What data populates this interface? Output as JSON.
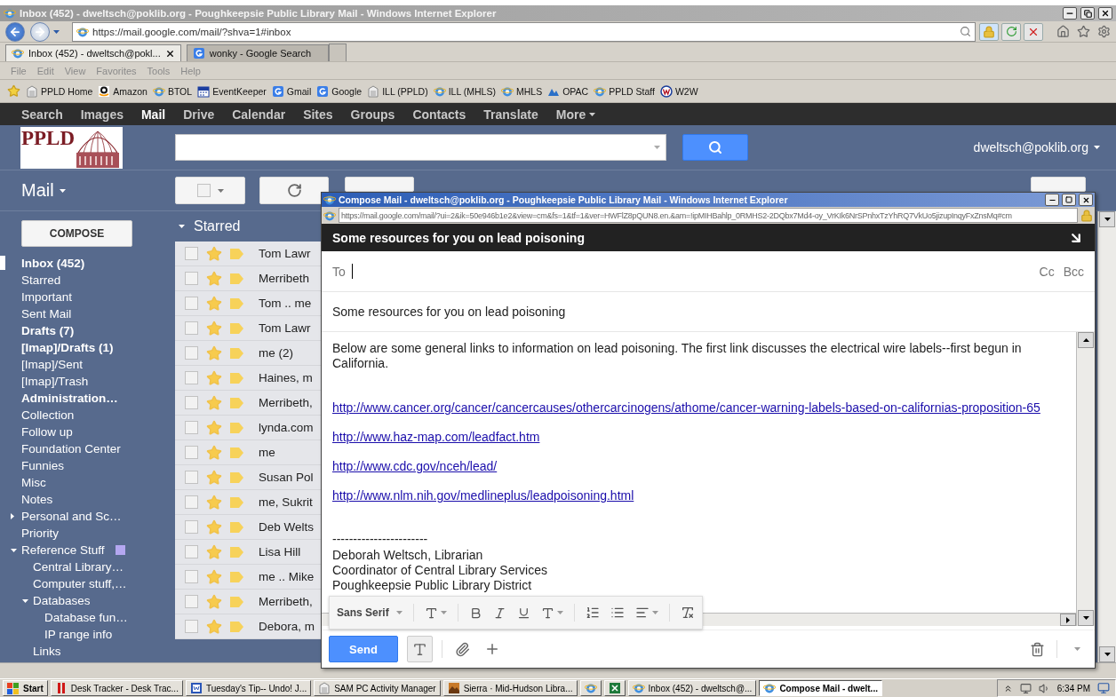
{
  "browser": {
    "title": "Inbox (452) - dweltsch@poklib.org - Poughkeepsie Public Library Mail - Windows Internet Explorer",
    "url": "https://mail.google.com/mail/?shva=1#inbox",
    "tabs": [
      {
        "label": "Inbox (452) - dweltsch@pokl...",
        "kind": "browser",
        "selected": true
      },
      {
        "label": "wonky - Google Search",
        "kind": "google",
        "selected": false
      }
    ],
    "menu": [
      "File",
      "Edit",
      "View",
      "Favorites",
      "Tools",
      "Help"
    ],
    "favorites": [
      {
        "label": "PPLD Home",
        "kind": "page"
      },
      {
        "label": "Amazon",
        "kind": "amazon"
      },
      {
        "label": "BTOL",
        "kind": "browser"
      },
      {
        "label": "EventKeeper",
        "kind": "calendar"
      },
      {
        "label": "Gmail",
        "kind": "google"
      },
      {
        "label": "Google",
        "kind": "google"
      },
      {
        "label": "ILL (PPLD)",
        "kind": "page"
      },
      {
        "label": "ILL (MHLS)",
        "kind": "browser"
      },
      {
        "label": "MHLS",
        "kind": "browser"
      },
      {
        "label": "OPAC",
        "kind": "wave"
      },
      {
        "label": "PPLD Staff",
        "kind": "browser"
      },
      {
        "label": "W2W",
        "kind": "ring"
      }
    ]
  },
  "google_bar": {
    "items": [
      {
        "label": "Search",
        "selected": false
      },
      {
        "label": "Images",
        "selected": false
      },
      {
        "label": "Mail",
        "selected": true
      },
      {
        "label": "Drive",
        "selected": false
      },
      {
        "label": "Calendar",
        "selected": false
      },
      {
        "label": "Sites",
        "selected": false
      },
      {
        "label": "Groups",
        "selected": false
      },
      {
        "label": "Contacts",
        "selected": false
      },
      {
        "label": "Translate",
        "selected": false
      },
      {
        "label": "More",
        "selected": false
      }
    ]
  },
  "gmail": {
    "logo": "PPLD",
    "account": "dweltsch@poklib.org",
    "app_switch": "Mail",
    "compose": "COMPOSE",
    "labels": [
      {
        "label": "Inbox (452)",
        "unread": true,
        "selected": true
      },
      {
        "label": "Starred",
        "unread": false,
        "selected": false
      },
      {
        "label": "Important",
        "unread": false,
        "selected": false
      },
      {
        "label": "Sent Mail",
        "unread": false,
        "selected": false
      },
      {
        "label": "Drafts (7)",
        "unread": true,
        "selected": false
      },
      {
        "label": "[Imap]/Drafts (1)",
        "unread": true,
        "selected": false
      },
      {
        "label": "[Imap]/Sent",
        "unread": false,
        "selected": false
      },
      {
        "label": "[Imap]/Trash",
        "unread": false,
        "selected": false
      },
      {
        "label": "Administration…",
        "unread": true,
        "selected": false
      },
      {
        "label": "Collection",
        "unread": false,
        "selected": false
      },
      {
        "label": "Follow up",
        "unread": false,
        "selected": false
      },
      {
        "label": "Foundation Center",
        "unread": false,
        "selected": false
      },
      {
        "label": "Funnies",
        "unread": false,
        "selected": false
      },
      {
        "label": "Misc",
        "unread": false,
        "selected": false
      },
      {
        "label": "Notes",
        "unread": false,
        "selected": false
      },
      {
        "label": "Personal and Sc…",
        "unread": false,
        "selected": false,
        "expanded": false
      },
      {
        "label": "Priority",
        "unread": false,
        "selected": false
      },
      {
        "label": "Reference Stuff",
        "unread": false,
        "selected": false,
        "expanded": true,
        "color": "#b4a7f0",
        "children": [
          {
            "label": "Central Library…",
            "unread": false,
            "selected": false
          },
          {
            "label": "Computer stuff,…",
            "unread": false,
            "selected": false
          },
          {
            "label": "Databases",
            "unread": false,
            "selected": false,
            "expanded": true,
            "children": [
              {
                "label": "Database fun…",
                "unread": false,
                "selected": false
              },
              {
                "label": "IP range info",
                "unread": false,
                "selected": false
              }
            ]
          },
          {
            "label": "Links",
            "unread": false,
            "selected": false
          }
        ]
      }
    ],
    "section": "Starred",
    "messages": [
      {
        "sender": "Tom Lawr",
        "checked": false,
        "starred": true
      },
      {
        "sender": "Merribeth",
        "checked": false,
        "starred": true
      },
      {
        "sender": "Tom .. me",
        "checked": false,
        "starred": true
      },
      {
        "sender": "Tom Lawr",
        "checked": false,
        "starred": true
      },
      {
        "sender": "me (2)",
        "checked": false,
        "starred": true
      },
      {
        "sender": "Haines, m",
        "checked": false,
        "starred": true
      },
      {
        "sender": "Merribeth,",
        "checked": false,
        "starred": true
      },
      {
        "sender": "lynda.com",
        "checked": false,
        "starred": true
      },
      {
        "sender": "me",
        "checked": false,
        "starred": true
      },
      {
        "sender": "Susan Pol",
        "checked": false,
        "starred": true
      },
      {
        "sender": "me, Sukrit",
        "checked": false,
        "starred": true
      },
      {
        "sender": "Deb Welts",
        "checked": false,
        "starred": true
      },
      {
        "sender": "Lisa Hill",
        "checked": false,
        "starred": true
      },
      {
        "sender": "me .. Mike",
        "checked": false,
        "starred": true
      },
      {
        "sender": "Merribeth,",
        "checked": false,
        "starred": true
      },
      {
        "sender": "Debora, m",
        "checked": false,
        "starred": true
      }
    ]
  },
  "compose_window": {
    "title": "Compose Mail - dweltsch@poklib.org - Poughkeepsie Public Library Mail - Windows Internet Explorer",
    "url": "https://mail.google.com/mail/?ui=2&ik=50e946b1e2&view=cm&fs=1&tf=1&ver=HWFlZ8pQUN8.en.&am=!ipMIHBahlp_0RMHS2-2DQbx7Md4-oy_VrKIk6NrSPnhxTzYhRQ7VkUo5jizupInqyFxZnsMq#cm",
    "heading": "Some resources for you on lead poisoning",
    "to_label": "To",
    "cc": "Cc",
    "bcc": "Bcc",
    "subject": "Some resources for you on lead poisoning",
    "body": [
      {
        "kind": "text",
        "text": "Below are some general links to information on lead poisoning. The first link discusses the electrical wire labels--first begun in California."
      },
      {
        "kind": "link",
        "text": "http://www.cancer.org/cancer/cancercauses/othercarcinogens/athome/cancer-warning-labels-based-on-californias-proposition-65"
      },
      {
        "kind": "link",
        "text": "http://www.haz-map.com/leadfact.htm"
      },
      {
        "kind": "link",
        "text": "http://www.cdc.gov/nceh/lead/"
      },
      {
        "kind": "link",
        "text": "http://www.nlm.nih.gov/medlineplus/leadpoisoning.html"
      },
      {
        "kind": "separator",
        "text": "-----------------------"
      },
      {
        "kind": "signature",
        "text": "Deborah Weltsch, Librarian"
      },
      {
        "kind": "signature",
        "text": "Coordinator of Central Library Services"
      },
      {
        "kind": "signature",
        "text": "Poughkeepsie Public Library District"
      }
    ],
    "font": "Sans Serif",
    "send": "Send"
  },
  "taskbar": {
    "start": "Start",
    "items": [
      {
        "label": "Desk Tracker - Desk Trac...",
        "kind": "bars",
        "selected": false
      },
      {
        "label": "Tuesday's Tip-- Undo!  J...",
        "kind": "document",
        "selected": false
      },
      {
        "label": "SAM PC Activity Manager",
        "kind": "page",
        "selected": false
      },
      {
        "label": "Sierra · Mid-Hudson Libra...",
        "kind": "landscape",
        "selected": false
      },
      {
        "kind": "browser",
        "selected": false
      },
      {
        "kind": "spreadsheet",
        "selected": false
      },
      {
        "label": "Inbox (452) - dweltsch@...",
        "kind": "browser",
        "selected": false
      },
      {
        "label": "Compose Mail - dwelt...",
        "kind": "browser",
        "selected": true
      }
    ],
    "clock": "6:34 PM"
  }
}
